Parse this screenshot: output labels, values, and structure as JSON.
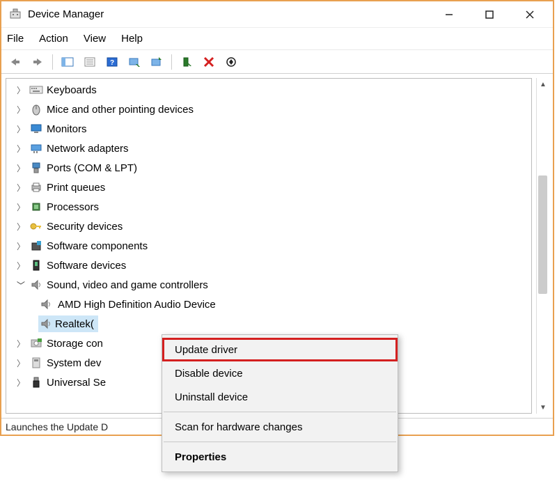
{
  "title": "Device Manager",
  "menu": {
    "file": "File",
    "action": "Action",
    "view": "View",
    "help": "Help"
  },
  "tree": {
    "keyboards": "Keyboards",
    "mice": "Mice and other pointing devices",
    "monitors": "Monitors",
    "network": "Network adapters",
    "ports": "Ports (COM & LPT)",
    "printq": "Print queues",
    "processors": "Processors",
    "security": "Security devices",
    "swcomp": "Software components",
    "swdev": "Software devices",
    "sound": "Sound, video and game controllers",
    "sound_child1": "AMD High Definition Audio Device",
    "sound_child2": "Realtek(",
    "storage": "Storage con",
    "sysdev": "System dev",
    "usb": "Universal Se"
  },
  "context": {
    "update": "Update driver",
    "disable": "Disable device",
    "uninstall": "Uninstall device",
    "scan": "Scan for hardware changes",
    "props": "Properties"
  },
  "status": "Launches the Update D"
}
